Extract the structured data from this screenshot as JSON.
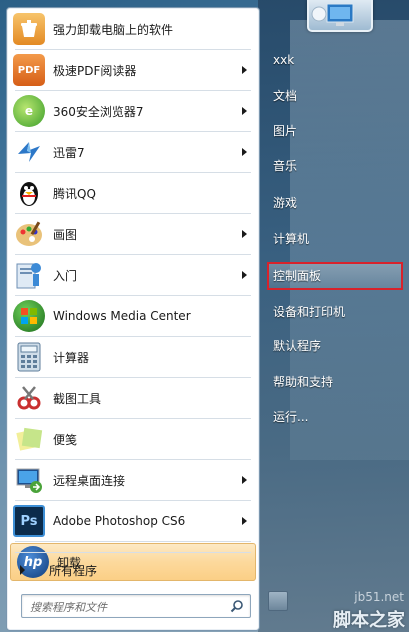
{
  "programs": [
    {
      "label": "强力卸载电脑上的软件",
      "icon": "uninstall-tool-icon",
      "color": "#f0a33a",
      "has_submenu": false
    },
    {
      "label": "极速PDF阅读器",
      "icon": "pdf-reader-icon",
      "color": "#e8762b",
      "has_submenu": true
    },
    {
      "label": "360安全浏览器7",
      "icon": "browser-360-icon",
      "color": "#4cae3c",
      "has_submenu": true
    },
    {
      "label": "迅雷7",
      "icon": "xunlei-icon",
      "color": "#3b82c4",
      "has_submenu": true
    },
    {
      "label": "腾讯QQ",
      "icon": "qq-penguin-icon",
      "color": "#222222",
      "has_submenu": false
    },
    {
      "label": "画图",
      "icon": "paint-palette-icon",
      "color": "#d98a3a",
      "has_submenu": true
    },
    {
      "label": "入门",
      "icon": "getting-started-icon",
      "color": "#5a9bd4",
      "has_submenu": true
    },
    {
      "label": "Windows Media Center",
      "icon": "windows-media-center-icon",
      "color": "#2f7f2f",
      "has_submenu": false
    },
    {
      "label": "计算器",
      "icon": "calculator-icon",
      "color": "#7fa6c8",
      "has_submenu": false
    },
    {
      "label": "截图工具",
      "icon": "snipping-tool-icon",
      "color": "#c94040",
      "has_submenu": false
    },
    {
      "label": "便笺",
      "icon": "sticky-notes-icon",
      "color": "#c9d66a",
      "has_submenu": false
    },
    {
      "label": "远程桌面连接",
      "icon": "remote-desktop-icon",
      "color": "#3a6fb0",
      "has_submenu": true
    },
    {
      "label": "Adobe Photoshop CS6",
      "icon": "photoshop-icon",
      "color": "#0a2a4a",
      "has_submenu": true
    },
    {
      "label": "卸载",
      "icon": "hp-logo-icon",
      "color": "#1d5fa8",
      "has_submenu": false,
      "highlighted": true
    }
  ],
  "all_programs_label": "所有程序",
  "search": {
    "placeholder": "搜索程序和文件"
  },
  "right_items": [
    {
      "label": "xxk",
      "key": "user"
    },
    {
      "label": "文档",
      "key": "documents"
    },
    {
      "label": "图片",
      "key": "pictures"
    },
    {
      "label": "音乐",
      "key": "music"
    },
    {
      "label": "游戏",
      "key": "games"
    },
    {
      "label": "计算机",
      "key": "computer"
    },
    {
      "label": "控制面板",
      "key": "control-panel",
      "highlighted": true
    },
    {
      "label": "设备和打印机",
      "key": "devices-printers"
    },
    {
      "label": "默认程序",
      "key": "default-programs"
    },
    {
      "label": "帮助和支持",
      "key": "help-support"
    },
    {
      "label": "运行...",
      "key": "run"
    }
  ],
  "watermark": {
    "site": "jb51.net",
    "brand": "脚本之家"
  },
  "colors": {
    "highlight_red": "#d8222b",
    "menu_highlight": "#fcd99c"
  }
}
